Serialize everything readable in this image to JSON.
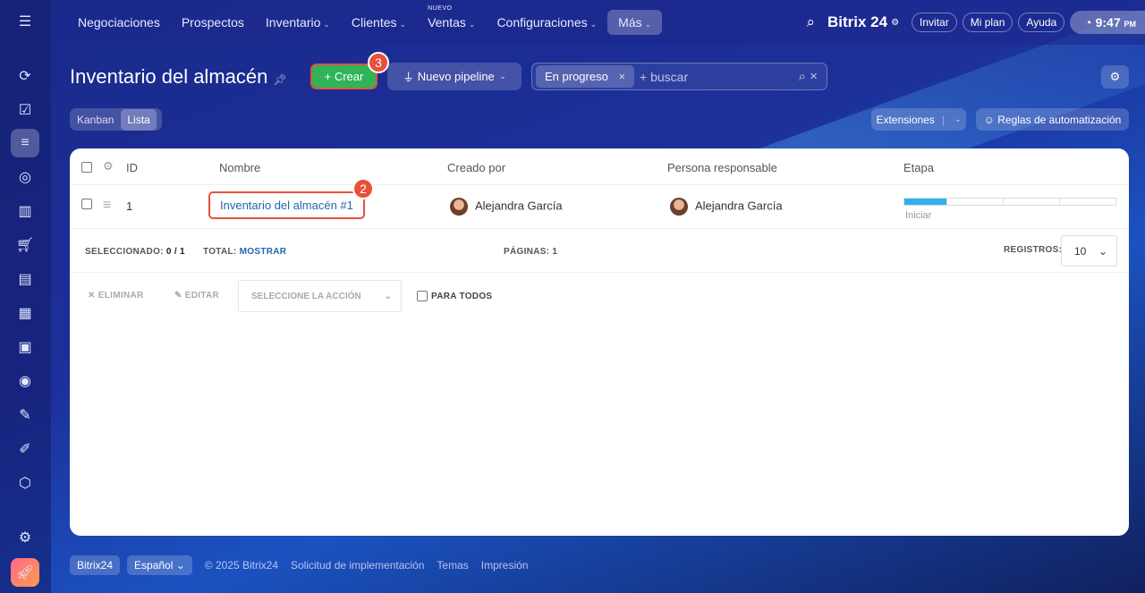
{
  "nav": {
    "items": [
      "Negociaciones",
      "Prospectos",
      "Inventario",
      "Clientes",
      "Ventas",
      "Configuraciones",
      "Más"
    ],
    "nuevo_label": "NUEVO"
  },
  "header": {
    "brand": "Bitrix 24",
    "invite": "Invitar",
    "plan": "Mi plan",
    "help": "Ayuda",
    "time": "9:47",
    "ampm": "PM"
  },
  "page": {
    "title": "Inventario del almacén",
    "create": "Crear",
    "pipeline": "Nuevo pipeline",
    "filter_tag": "En progreso",
    "search_placeholder": "+ buscar",
    "view_kanban": "Kanban",
    "view_list": "Lista",
    "extensions": "Extensiones",
    "automation": "Reglas de automatización",
    "badge_create": "3",
    "badge_name": "2"
  },
  "table": {
    "headers": [
      "ID",
      "Nombre",
      "Creado por",
      "Persona responsable",
      "Etapa"
    ],
    "rows": [
      {
        "id": "1",
        "name": "Inventario del almacén #1",
        "created_by": "Alejandra García",
        "responsible": "Alejandra García",
        "stage": "Iniciar",
        "stage_progress": 0.2
      }
    ]
  },
  "summary": {
    "selected_label": "SELECCIONADO:",
    "selected_value": "0 / 1",
    "total_label": "TOTAL:",
    "total_link": "MOSTRAR",
    "pages_label": "PÁGINAS:",
    "pages_value": "1",
    "records_label": "REGISTROS:",
    "records_value": "10"
  },
  "actions": {
    "delete": "ELIMINAR",
    "edit": "EDITAR",
    "select_action": "SELECCIONE LA ACCIÓN",
    "for_all": "PARA TODOS"
  },
  "footer": {
    "brand": "Bitrix24",
    "language": "Español",
    "copyright": "© 2025 Bitrix24",
    "links": [
      "Solicitud de implementación",
      "Temas",
      "Impresión"
    ]
  }
}
